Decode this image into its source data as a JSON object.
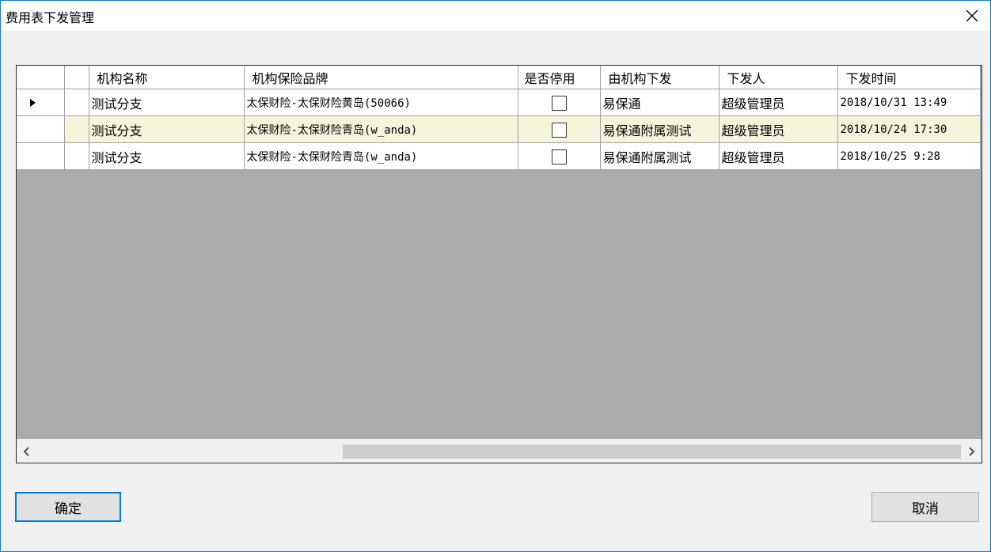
{
  "window": {
    "title": "费用表下发管理"
  },
  "grid": {
    "columns": [
      "机构名称",
      "机构保险品牌",
      "是否停用",
      "由机构下发",
      "下发人",
      "下发时间"
    ],
    "rows": [
      {
        "org": "测试分支",
        "brand": "太保财险-太保财险黄岛(50066)",
        "disabled": false,
        "dispatch_org": "易保通",
        "issuer": "超级管理员",
        "time": "2018/10/31 13:49",
        "current": true
      },
      {
        "org": "测试分支",
        "brand": "太保财险-太保财险青岛(w_anda)",
        "disabled": false,
        "dispatch_org": "易保通附属测试",
        "issuer": "超级管理员",
        "time": "2018/10/24 17:30",
        "current": false
      },
      {
        "org": "测试分支",
        "brand": "太保财险-太保财险青岛(w_anda)",
        "disabled": false,
        "dispatch_org": "易保通附属测试",
        "issuer": "超级管理员",
        "time": "2018/10/25 9:28",
        "current": false
      }
    ],
    "alt_row_color": "#f5f5dc",
    "empty_area_color": "#ababab"
  },
  "buttons": {
    "ok_label": "确定",
    "cancel_label": "取消"
  },
  "colors": {
    "accent": "#0078d7",
    "window_border": "#1979ca"
  }
}
